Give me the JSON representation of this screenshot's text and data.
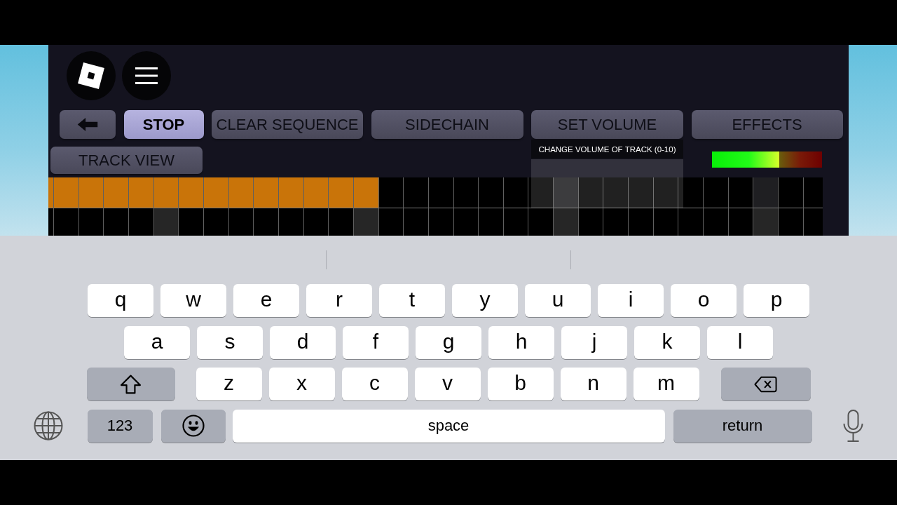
{
  "toolbar": {
    "buttons": [
      {
        "kind": "back",
        "selected": false
      },
      {
        "kind": "text",
        "label": "STOP",
        "selected": true
      },
      {
        "kind": "text",
        "label": "CLEAR SEQUENCE",
        "selected": false
      },
      {
        "kind": "text",
        "label": "SIDECHAIN",
        "selected": false
      },
      {
        "kind": "text",
        "label": "SET VOLUME",
        "selected": false,
        "tooltip": "CHANGE VOLUME OF TRACK (0-10)"
      },
      {
        "kind": "text",
        "label": "EFFECTS",
        "selected": false
      }
    ]
  },
  "track_view_button": {
    "label": "TRACK VIEW"
  },
  "volume_meter": {
    "level": 0.61
  },
  "sequencer": {
    "columns": [
      {
        "accent": false
      },
      {
        "accent": false
      },
      {
        "accent": false
      },
      {
        "accent": false
      },
      {
        "accent": false
      },
      {
        "accent": true
      },
      {
        "accent": false
      },
      {
        "accent": false
      },
      {
        "accent": false
      },
      {
        "accent": false
      },
      {
        "accent": false
      },
      {
        "accent": false
      },
      {
        "accent": false
      },
      {
        "accent": true
      },
      {
        "accent": false
      },
      {
        "accent": false
      },
      {
        "accent": false
      },
      {
        "accent": false
      },
      {
        "accent": false
      },
      {
        "accent": false
      },
      {
        "accent": false
      },
      {
        "accent": true
      },
      {
        "accent": false
      },
      {
        "accent": false
      },
      {
        "accent": false
      },
      {
        "accent": false
      },
      {
        "accent": false
      },
      {
        "accent": false
      },
      {
        "accent": false
      },
      {
        "accent": true
      },
      {
        "accent": false
      },
      {
        "accent": false
      }
    ],
    "tracks": [
      {
        "steps": [
          {
            "on": true
          },
          {
            "on": true
          },
          {
            "on": true
          },
          {
            "on": true
          },
          {
            "on": true
          },
          {
            "on": true
          },
          {
            "on": true
          },
          {
            "on": true
          },
          {
            "on": true
          },
          {
            "on": true
          },
          {
            "on": true
          },
          {
            "on": true
          },
          {
            "on": true
          },
          {
            "on": true
          },
          {
            "on": false
          },
          {
            "on": false
          },
          {
            "on": false
          },
          {
            "on": false
          },
          {
            "on": false
          },
          {
            "on": false
          },
          {
            "on": false
          },
          {
            "on": false
          },
          {
            "on": false
          },
          {
            "on": false
          },
          {
            "on": false
          },
          {
            "on": false
          },
          {
            "on": false
          },
          {
            "on": false
          },
          {
            "on": false
          },
          {
            "on": false
          },
          {
            "on": false
          },
          {
            "on": false
          }
        ]
      },
      {
        "steps": [
          {
            "on": false
          },
          {
            "on": false
          },
          {
            "on": false
          },
          {
            "on": false
          },
          {
            "on": false
          },
          {
            "on": false
          },
          {
            "on": false
          },
          {
            "on": false
          },
          {
            "on": false
          },
          {
            "on": false
          },
          {
            "on": false
          },
          {
            "on": false
          },
          {
            "on": false
          },
          {
            "on": false
          },
          {
            "on": false
          },
          {
            "on": false
          },
          {
            "on": false
          },
          {
            "on": false
          },
          {
            "on": false
          },
          {
            "on": false
          },
          {
            "on": false
          },
          {
            "on": false
          },
          {
            "on": false
          },
          {
            "on": false
          },
          {
            "on": false
          },
          {
            "on": false
          },
          {
            "on": false
          },
          {
            "on": false
          },
          {
            "on": false
          },
          {
            "on": false
          },
          {
            "on": false
          },
          {
            "on": false
          }
        ]
      }
    ]
  },
  "keyboard": {
    "rows": [
      {
        "keys": [
          {
            "kind": "letter",
            "label": "q"
          },
          {
            "kind": "letter",
            "label": "w"
          },
          {
            "kind": "letter",
            "label": "e"
          },
          {
            "kind": "letter",
            "label": "r"
          },
          {
            "kind": "letter",
            "label": "t"
          },
          {
            "kind": "letter",
            "label": "y"
          },
          {
            "kind": "letter",
            "label": "u"
          },
          {
            "kind": "letter",
            "label": "i"
          },
          {
            "kind": "letter",
            "label": "o"
          },
          {
            "kind": "letter",
            "label": "p"
          }
        ]
      },
      {
        "keys": [
          {
            "kind": "letter",
            "label": "a"
          },
          {
            "kind": "letter",
            "label": "s"
          },
          {
            "kind": "letter",
            "label": "d"
          },
          {
            "kind": "letter",
            "label": "f"
          },
          {
            "kind": "letter",
            "label": "g"
          },
          {
            "kind": "letter",
            "label": "h"
          },
          {
            "kind": "letter",
            "label": "j"
          },
          {
            "kind": "letter",
            "label": "k"
          },
          {
            "kind": "letter",
            "label": "l"
          }
        ]
      },
      {
        "keys": [
          {
            "kind": "shift"
          },
          {
            "kind": "letter",
            "label": "z"
          },
          {
            "kind": "letter",
            "label": "x"
          },
          {
            "kind": "letter",
            "label": "c"
          },
          {
            "kind": "letter",
            "label": "v"
          },
          {
            "kind": "letter",
            "label": "b"
          },
          {
            "kind": "letter",
            "label": "n"
          },
          {
            "kind": "letter",
            "label": "m"
          },
          {
            "kind": "delete"
          }
        ]
      },
      {
        "keys": [
          {
            "kind": "globe"
          },
          {
            "kind": "numbers",
            "label": "123"
          },
          {
            "kind": "emoji"
          },
          {
            "kind": "space",
            "label": "space"
          },
          {
            "kind": "return",
            "label": "return"
          },
          {
            "kind": "dictation"
          }
        ]
      }
    ]
  }
}
